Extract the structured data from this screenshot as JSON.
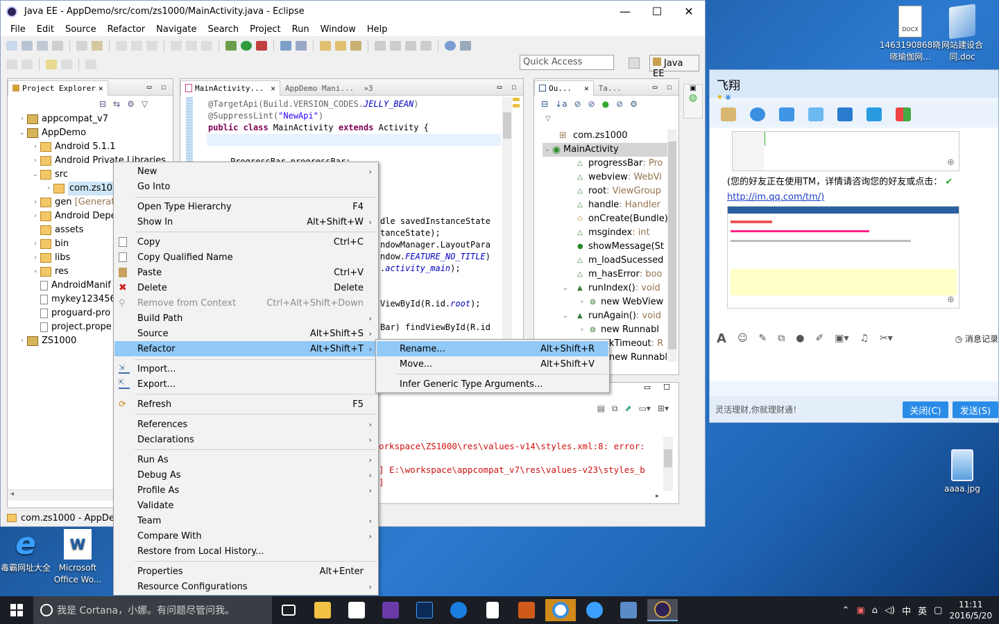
{
  "window": {
    "title": "Java EE - AppDemo/src/com/zs1000/MainActivity.java - Eclipse"
  },
  "menubar": [
    "File",
    "Edit",
    "Source",
    "Refactor",
    "Navigate",
    "Search",
    "Project",
    "Run",
    "Window",
    "Help"
  ],
  "quick_access": {
    "placeholder": "Quick Access"
  },
  "perspective": "Java EE",
  "explorer": {
    "tab": "Project Explorer",
    "items": [
      "appcompat_v7",
      "AppDemo",
      "Android 5.1.1",
      "Android Private Libraries",
      "src",
      "com.zs100",
      "gen",
      "[Generate",
      "Android Depe",
      "assets",
      "bin",
      "libs",
      "res",
      "AndroidManif",
      "mykey123456",
      "proguard-pro",
      "project.prope",
      "ZS1000"
    ],
    "status": "com.zs1000 - AppDem"
  },
  "editor": {
    "tabs": [
      "MainActivity...",
      "AppDemo Mani...",
      "»3"
    ],
    "code": {
      "l1a": "@TargetApi(Build.VERSION_CODES.",
      "l1b": "JELLY_BEAN",
      "l1c": ")",
      "l2a": "@SuppressLint(",
      "l2b": "\"NewApi\"",
      "l2c": ")",
      "l3a": "public class",
      "l3b": " MainActivity ",
      "l3c": "extends",
      "l3d": " Activity {",
      "l4": "ProgressBar progressBar;",
      "r1": "dle savedInstanceState",
      "r2": "tanceState);",
      "r3": "ndowManager.LayoutPara",
      "r4a": "ndow.",
      "r4b": "FEATURE_NO_TITLE",
      "r4c": ")",
      "r5a": ".",
      "r5b": "activity_main",
      "r5c": ");",
      "r6a": "ViewById(R.id.",
      "r6b": "root",
      "r6c": ");",
      "r7": "Bar) findViewById(R.id"
    }
  },
  "outline": {
    "tabs": [
      "Ou...",
      "Ta..."
    ],
    "items": [
      {
        "name": "com.zs1000",
        "type": ""
      },
      {
        "name": "MainActivity",
        "type": ""
      },
      {
        "name": "progressBar",
        "type": " : Pro"
      },
      {
        "name": "webview",
        "type": " : WebVi"
      },
      {
        "name": "root",
        "type": " : ViewGroup"
      },
      {
        "name": "handle",
        "type": " : Handler"
      },
      {
        "name": "onCreate(Bundle)",
        "type": ""
      },
      {
        "name": "msgindex",
        "type": " : int"
      },
      {
        "name": "showMessage(St",
        "type": ""
      },
      {
        "name": "m_loadSucessed",
        "type": ""
      },
      {
        "name": "m_hasError",
        "type": " : boo"
      },
      {
        "name": "runIndex()",
        "type": " : void"
      },
      {
        "name": "new WebView",
        "type": ""
      },
      {
        "name": "runAgain()",
        "type": " : void"
      },
      {
        "name": "new Runnabl",
        "type": ""
      },
      {
        "name": "kTimeout",
        "type": " : R"
      },
      {
        "name": "new Runnabl",
        "type": ""
      }
    ]
  },
  "console": {
    "line1": "orkspace\\ZS1000\\res\\values-v14\\styles.xml:8: error:",
    "line2": "] E:\\workspace\\appcompat_v7\\res\\values-v23\\styles_b",
    "line3": "]"
  },
  "context_menu": [
    {
      "label": "New",
      "accel": "",
      "sub": true
    },
    {
      "label": "Go Into",
      "accel": "",
      "sub": false
    },
    {
      "label": "Open Type Hierarchy",
      "accel": "F4",
      "sub": false
    },
    {
      "label": "Show In",
      "accel": "Alt+Shift+W",
      "sub": true
    },
    {
      "label": "Copy",
      "accel": "Ctrl+C",
      "sub": false
    },
    {
      "label": "Copy Qualified Name",
      "accel": "",
      "sub": false
    },
    {
      "label": "Paste",
      "accel": "Ctrl+V",
      "sub": false
    },
    {
      "label": "Delete",
      "accel": "Delete",
      "sub": false
    },
    {
      "label": "Remove from Context",
      "accel": "Ctrl+Alt+Shift+Down",
      "sub": false
    },
    {
      "label": "Build Path",
      "accel": "",
      "sub": true
    },
    {
      "label": "Source",
      "accel": "Alt+Shift+S",
      "sub": true
    },
    {
      "label": "Refactor",
      "accel": "Alt+Shift+T",
      "sub": true
    },
    {
      "label": "Import...",
      "accel": "",
      "sub": false
    },
    {
      "label": "Export...",
      "accel": "",
      "sub": false
    },
    {
      "label": "Refresh",
      "accel": "F5",
      "sub": false
    },
    {
      "label": "References",
      "accel": "",
      "sub": true
    },
    {
      "label": "Declarations",
      "accel": "",
      "sub": true
    },
    {
      "label": "Run As",
      "accel": "",
      "sub": true
    },
    {
      "label": "Debug As",
      "accel": "",
      "sub": true
    },
    {
      "label": "Profile As",
      "accel": "",
      "sub": true
    },
    {
      "label": "Validate",
      "accel": "",
      "sub": false
    },
    {
      "label": "Team",
      "accel": "",
      "sub": true
    },
    {
      "label": "Compare With",
      "accel": "",
      "sub": true
    },
    {
      "label": "Restore from Local History...",
      "accel": "",
      "sub": false
    },
    {
      "label": "Properties",
      "accel": "Alt+Enter",
      "sub": false
    },
    {
      "label": "Resource Configurations",
      "accel": "",
      "sub": true
    }
  ],
  "submenu": [
    {
      "label": "Rename...",
      "accel": "Alt+Shift+R"
    },
    {
      "label": "Move...",
      "accel": "Alt+Shift+V"
    },
    {
      "label": "Infer Generic Type Arguments...",
      "accel": ""
    }
  ],
  "qq": {
    "title": "飞翔",
    "notice": "(您的好友正在使用TM，详情请咨询您的好友或点击：",
    "link": "http://im.qq.com/tm/)",
    "history": "消息记录",
    "footer": "灵活理财,你就理财通！",
    "close": "关闭(C)",
    "send": "发送(S)"
  },
  "desktop_icons": [
    {
      "label": "1463190868晓晓瑜伽网..."
    },
    {
      "label": "网站建设合同.doc"
    },
    {
      "label": "aaaa.jpg"
    },
    {
      "label": "毒霸网址大全"
    },
    {
      "label": "Microsoft Office Wo..."
    }
  ],
  "taskbar": {
    "search": "我是 Cortana，小娜。有问题尽管问我。",
    "ime": "英",
    "time": "11:11",
    "date": "2016/5/20"
  },
  "colors": {
    "highlight": "#91c9f7",
    "accent": "#2b8ce8",
    "error": "#d01010"
  }
}
